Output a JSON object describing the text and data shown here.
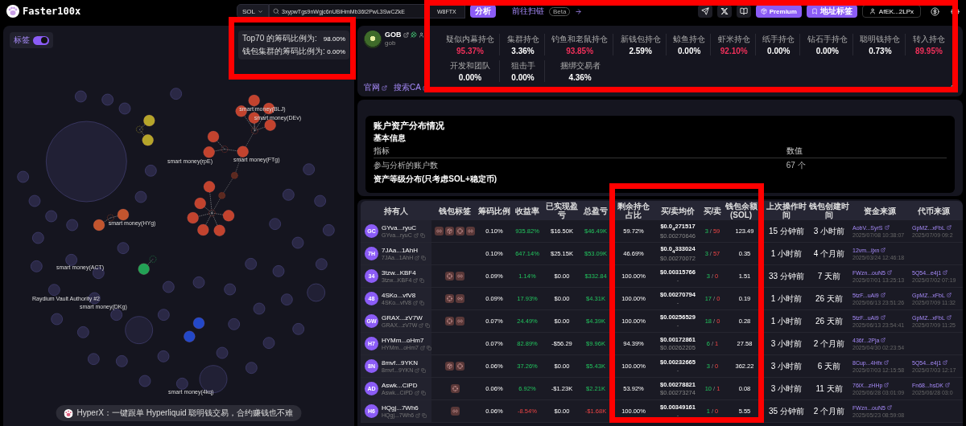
{
  "topbar": {
    "brand": "Faster100x",
    "chain": "SOL",
    "address_parts": [
      "3xypwTgs9nWgjc6nUBiHmMb36t2PwL3SwCZkE",
      "W8FTX"
    ],
    "analyze_button": "分析",
    "scan_link": "前往扫链",
    "scan_badge": "Beta",
    "premium_button": "Premium",
    "labels_button": "地址标签",
    "account": "AfEK...2LPx"
  },
  "map_panel": {
    "toggle": {
      "label": "标签",
      "on": true
    },
    "ratios": [
      {
        "label": "Top70 的筹码比例为:",
        "value": "98.00%"
      },
      {
        "label": "钱包集群的筹码比例为:",
        "value": "0.00%"
      }
    ],
    "node_labels": [
      "smart money(BLJ)",
      "smart money(DEv)",
      "smart money(rpE)",
      "smart money(FTg)",
      "smart money(HYg)",
      "smart money(ACT)",
      "Raydium Vault Authority #2",
      "smart money(DKg)",
      "smart money(4kq)"
    ],
    "banner": "HyperX：一键跟单 Hyperliquid 聪明钱交易，合约赚钱也不难"
  },
  "token": {
    "symbol": "GOB",
    "name": "gob",
    "links": [
      "官网",
      "搜索CA"
    ],
    "stats": [
      {
        "label": "疑似内幕持仓",
        "value": "95.37%",
        "alert": true
      },
      {
        "label": "集群持仓",
        "value": "3.36%",
        "alert": false
      },
      {
        "label": "钓鱼和老鼠持仓",
        "value": "93.85%",
        "alert": true
      },
      {
        "label": "新钱包持仓",
        "value": "2.59%",
        "alert": false
      },
      {
        "label": "鲸鱼持仓",
        "value": "0.00%",
        "alert": false
      },
      {
        "label": "虾米持仓",
        "value": "92.10%",
        "alert": true
      },
      {
        "label": "纸手持仓",
        "value": "0.00%",
        "alert": false
      },
      {
        "label": "钻石手持仓",
        "value": "0.00%",
        "alert": false
      },
      {
        "label": "聪明钱持仓",
        "value": "0.73%",
        "alert": false
      },
      {
        "label": "转入持仓",
        "value": "89.95%",
        "alert": true
      },
      {
        "label": "开发和团队",
        "value": "0.00%",
        "alert": false
      },
      {
        "label": "狙击手",
        "value": "0.00%",
        "alert": false
      },
      {
        "label": "捆绑交易者",
        "value": "4.36%",
        "alert": false
      }
    ]
  },
  "assets": {
    "title": "账户资产分布情况",
    "section": "基本信息",
    "columns": [
      "指标",
      "数值"
    ],
    "rows": [
      [
        "参与分析的账户数",
        "67 个"
      ]
    ],
    "subsection": "资产等级分布(只考虑SOL+稳定币)"
  },
  "holders": {
    "columns": [
      "持有人",
      "钱包标签",
      "筹码比例",
      "收益率",
      "已实现盈亏",
      "总盈亏",
      "剩余持仓占比",
      "买/卖均价",
      "买/卖",
      "钱包余额(SOL)",
      "上次操作时间",
      "钱包创建时间",
      "资金来源",
      "代币来源"
    ],
    "rows": [
      {
        "avatar": "GC",
        "name": "GYva...ryuC",
        "short": "GYva...ryuC",
        "tags": [
          {
            "kind": "chain"
          },
          {
            "kind": "package"
          },
          {
            "kind": "target"
          },
          {
            "kind": "chain"
          }
        ],
        "share": "0.10%",
        "yield": "935.82%",
        "yield_gain": true,
        "realized": "$16.50K",
        "total": "$46.49K",
        "total_gain": true,
        "remaining": "59.72%",
        "buy_avg": "$0.0$_{4}$271517",
        "sell_avg": "$0.00270646",
        "buys": "3",
        "separator": "/",
        "sells": "59",
        "balance": "123.49",
        "last_op": "15 分钟前",
        "created": "3 小时前",
        "fund_source": {
          "address": "AobV...SyrS",
          "time": "2025/07/08 10:38:07"
        },
        "token_source": {
          "address": "GpMZ...xFbL",
          "time": "2025/07/09 09:2"
        }
      },
      {
        "avatar": "7H",
        "name": "7JAa...1AhH",
        "short": "7JAa...1AhH",
        "tags": [],
        "share": "0.10%",
        "yield": "647.14%",
        "yield_gain": true,
        "realized": "$25.15K",
        "total": "$53.09K",
        "total_gain": true,
        "remaining": "46.69%",
        "buy_avg": "$0.0$_{4}$333024",
        "sell_avg": "$0.00270072",
        "buys": "3",
        "separator": "/",
        "sells": "57",
        "balance": "0.35",
        "last_op": "1 小时前",
        "created": "4 个月前",
        "fund_source": {
          "address": "12vm...ijxn",
          "time": "2025/03/24 12:46:18"
        }
      },
      {
        "avatar": "34",
        "name": "3tzw...KBF4",
        "short": "3tzw...KBF4",
        "tags": [
          {
            "kind": "target"
          },
          {
            "kind": "chain"
          }
        ],
        "share": "0.09%",
        "yield": "1.14%",
        "yield_gain": true,
        "realized": "$0.00",
        "total": "$332.84",
        "total_gain": true,
        "remaining": "100.00%",
        "buy_avg": "$0.00315766",
        "sell_avg": "-",
        "buys": "3",
        "separator": "/",
        "sells": "0",
        "balance": "1.51",
        "last_op": "33 分钟前",
        "created": "7 天前",
        "fund_source": {
          "address": "FWzn...ouN5",
          "time": "2025/07/01 13:25:13"
        },
        "token_source": {
          "address": "5Q54...e4j1",
          "time": "2025/07/02 07:19"
        }
      },
      {
        "avatar": "48",
        "name": "4SKo...vfV8",
        "short": "4SKo...vfV8",
        "tags": [
          {
            "kind": "target"
          },
          {
            "kind": "chain"
          }
        ],
        "share": "0.09%",
        "yield": "17.93%",
        "yield_gain": true,
        "realized": "$0.00",
        "total": "$4.31K",
        "total_gain": true,
        "remaining": "100.00%",
        "buy_avg": "$0.00270794",
        "sell_avg": "-",
        "buys": "17",
        "separator": "/",
        "sells": "0",
        "balance": "0.19",
        "last_op": "1 小时前",
        "created": "26 天前",
        "fund_source": {
          "address": "5tzF...uAi9",
          "time": "2025/06/13 23:51:26"
        },
        "token_source": {
          "address": "GpMZ...xFbL",
          "time": "2025/07/09 11:32"
        }
      },
      {
        "avatar": "GW",
        "name": "GRAX...zV7W",
        "short": "GRAX...zV7W",
        "tags": [
          {
            "kind": "target"
          },
          {
            "kind": "chain"
          }
        ],
        "share": "0.07%",
        "yield": "24.49%",
        "yield_gain": true,
        "realized": "$0.00",
        "total": "$4.39K",
        "total_gain": true,
        "remaining": "100.00%",
        "buy_avg": "$0.00256529",
        "sell_avg": "-",
        "buys": "18",
        "separator": "/",
        "sells": "0",
        "balance": "0.28",
        "last_op": "1 小时前",
        "created": "26 天前",
        "fund_source": {
          "address": "5tzF...uAi9",
          "time": "2025/06/13 23:54:41"
        },
        "token_source": {
          "address": "GpMZ...xFbL",
          "time": "2025/07/09 11:25"
        }
      },
      {
        "avatar": "H7",
        "name": "HYMm...oHm7",
        "short": "HYMm...oHm7",
        "tags": [],
        "share": "0.07%",
        "yield": "82.89%",
        "yield_gain": true,
        "realized": "-$56.29",
        "total": "$9.96K",
        "total_gain": true,
        "remaining": "94.39%",
        "buy_avg": "$0.00172861",
        "sell_avg": "$0.00262205",
        "buys": "6",
        "separator": "/",
        "sells": "1",
        "balance": "27.58",
        "last_op": "3 小时前",
        "created": "2 个月前",
        "fund_source": {
          "address": "436f...2Pja",
          "time": "2025/04/30 02:23:54"
        }
      },
      {
        "avatar": "8N",
        "name": "8mvf...9YKN",
        "short": "8mvf...9YKN",
        "tags": [
          {
            "kind": "package"
          },
          {
            "kind": "target"
          }
        ],
        "share": "0.06%",
        "yield": "37.26%",
        "yield_gain": true,
        "realized": "$0.00",
        "total": "$5.43K",
        "total_gain": true,
        "remaining": "100.00%",
        "buy_avg": "$0.00232665",
        "sell_avg": "-",
        "buys": "3",
        "separator": "/",
        "sells": "0",
        "balance": "362.22",
        "last_op": "3 小时前",
        "created": "6 天前",
        "fund_source": {
          "address": "8Cup...4Hfx",
          "time": "2025/07/03 12:15:58"
        },
        "token_source": {
          "address": "5Q54...e4j1",
          "time": "2025/07/03 12:17"
        }
      },
      {
        "avatar": "AD",
        "name": "Aswk...CiPD",
        "short": "Aswk...CiPD",
        "tags": [
          {
            "kind": "target"
          }
        ],
        "share": "0.06%",
        "yield": "6.92%",
        "yield_gain": true,
        "realized": "-$1.23K",
        "total": "$2.21K",
        "total_gain": true,
        "remaining": "53.92%",
        "buy_avg": "$0.00278821",
        "sell_avg": "$0.00273274",
        "buys": "10",
        "separator": "/",
        "sells": "1",
        "balance": "0.08",
        "last_op": "3 小时前",
        "created": "11 天前",
        "fund_source": {
          "address": "76iX...zHHp",
          "time": "2025/06/28 03:01:09"
        },
        "token_source": {
          "address": "Fn68...hsDK",
          "time": "2025/06/28 03:0"
        }
      },
      {
        "avatar": "H6",
        "name": "HQgj...7Wh6",
        "short": "HQgj...7Wh6",
        "tags": [
          {
            "kind": "chain"
          }
        ],
        "share": "0.06%",
        "yield": "-8.54%",
        "yield_gain": false,
        "realized": "$0.00",
        "total": "-$1.68K",
        "total_gain": false,
        "remaining": "100.00%",
        "buy_avg": "$0.00349161",
        "sell_avg": "-",
        "buys": "1",
        "separator": "/",
        "sells": "0",
        "balance": "5.55",
        "last_op": "35 分钟前",
        "created": "2 个月前",
        "fund_source": {
          "address": "FWzn...ouN5",
          "time": "2025/05/23 08:59:08"
        }
      }
    ]
  }
}
